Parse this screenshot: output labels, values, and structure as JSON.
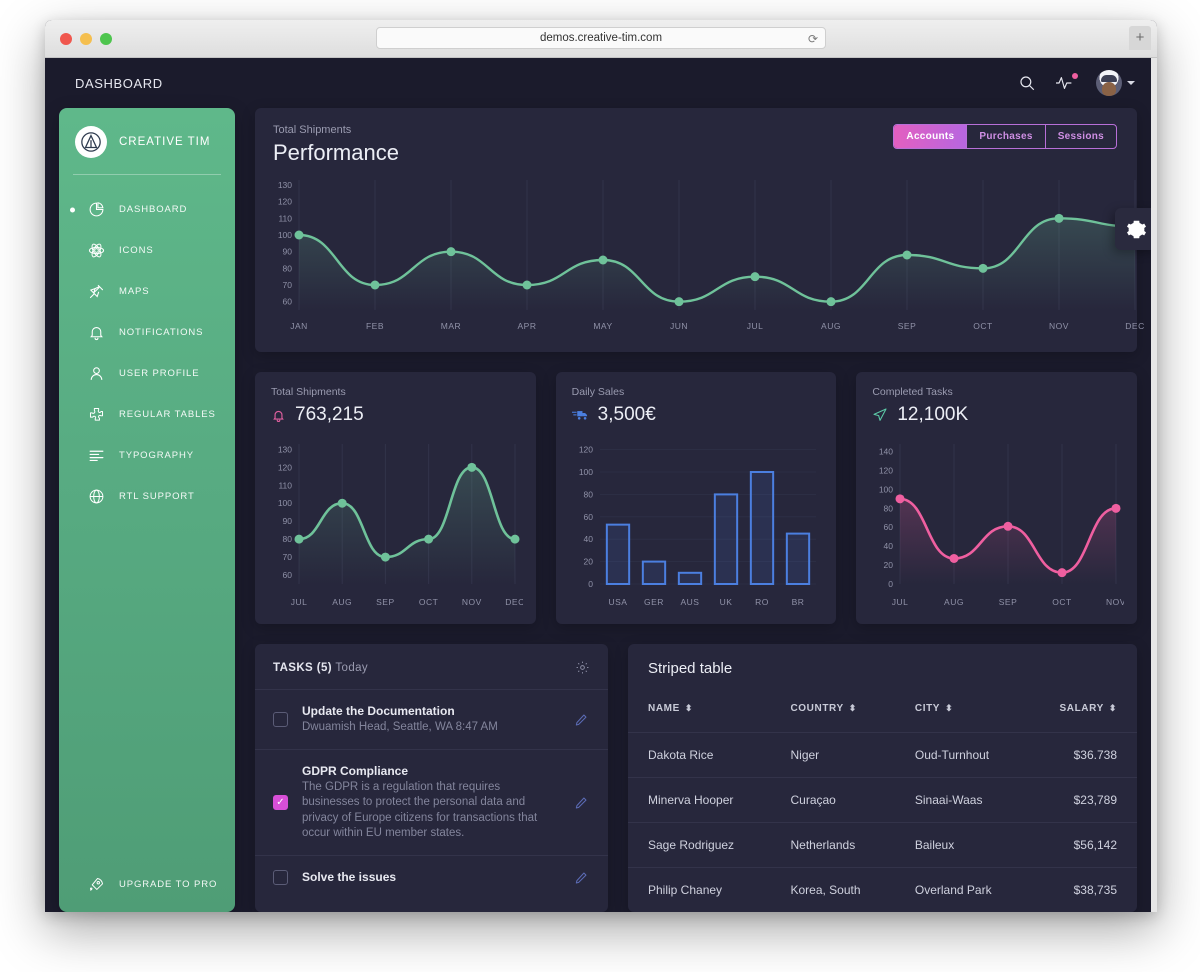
{
  "browser": {
    "url": "demos.creative-tim.com",
    "reload_icon": "reload-icon",
    "new_tab_label": "+"
  },
  "appbar": {
    "title": "DASHBOARD",
    "search_icon": "search-icon",
    "activity_icon": "activity-pulse-icon",
    "avatar": "user-avatar"
  },
  "sidebar": {
    "brand": "CREATIVE TIM",
    "items": [
      {
        "label": "DASHBOARD",
        "icon": "pie-chart-icon",
        "active": true
      },
      {
        "label": "ICONS",
        "icon": "atom-icon",
        "active": false
      },
      {
        "label": "MAPS",
        "icon": "pin-icon",
        "active": false
      },
      {
        "label": "NOTIFICATIONS",
        "icon": "bell-icon",
        "active": false
      },
      {
        "label": "USER PROFILE",
        "icon": "user-icon",
        "active": false
      },
      {
        "label": "REGULAR TABLES",
        "icon": "puzzle-icon",
        "active": false
      },
      {
        "label": "TYPOGRAPHY",
        "icon": "text-align-icon",
        "active": false
      },
      {
        "label": "RTL SUPPORT",
        "icon": "globe-icon",
        "active": false
      }
    ],
    "footer": {
      "label": "UPGRADE TO PRO",
      "icon": "rocket-icon"
    }
  },
  "performance": {
    "subtitle": "Total Shipments",
    "title": "Performance",
    "toggles": [
      {
        "label": "Accounts",
        "active": true
      },
      {
        "label": "Purchases",
        "active": false
      },
      {
        "label": "Sessions",
        "active": false
      }
    ]
  },
  "settings_fab": {
    "icon": "gear-icon"
  },
  "stats": [
    {
      "label": "Total Shipments",
      "value": "763,215",
      "icon": "bell-icon",
      "icon_color": "#e0609f"
    },
    {
      "label": "Daily Sales",
      "value": "3,500€",
      "icon": "shipping-fast-icon",
      "icon_color": "#4b7fe0"
    },
    {
      "label": "Completed Tasks",
      "value": "12,100K",
      "icon": "send-icon",
      "icon_color": "#5cc9a7"
    }
  ],
  "tasks_panel": {
    "title_bold": "TASKS (5)",
    "title_rest": "Today",
    "settings_icon": "gear-icon",
    "items": [
      {
        "checked": false,
        "name": "Update the Documentation",
        "desc": "Dwuamish Head, Seattle, WA 8:47 AM",
        "edit_icon": "pencil-icon"
      },
      {
        "checked": true,
        "name": "GDPR Compliance",
        "desc": "The GDPR is a regulation that requires businesses to protect the personal data and privacy of Europe citizens for transactions that occur within EU member states.",
        "edit_icon": "pencil-icon"
      },
      {
        "checked": false,
        "name": "Solve the issues",
        "desc": "",
        "edit_icon": "pencil-icon"
      }
    ]
  },
  "table": {
    "title": "Striped table",
    "sort_icon": "sort-updown-icon",
    "columns": [
      "NAME",
      "COUNTRY",
      "CITY",
      "SALARY"
    ],
    "rows": [
      [
        "Dakota Rice",
        "Niger",
        "Oud-Turnhout",
        "$36.738"
      ],
      [
        "Minerva Hooper",
        "Curaçao",
        "Sinaai-Waas",
        "$23,789"
      ],
      [
        "Sage Rodriguez",
        "Netherlands",
        "Baileux",
        "$56,142"
      ],
      [
        "Philip Chaney",
        "Korea, South",
        "Overland Park",
        "$38,735"
      ]
    ]
  },
  "colors": {
    "accent_green": "#6fc29a",
    "accent_pink": "#ef5fa0",
    "accent_blue": "#4b7fe0",
    "accent_purple": "#b766e0",
    "card_bg": "#27273c",
    "page_bg": "#1b1b2c"
  },
  "chart_data": [
    {
      "type": "line",
      "name": "performance-chart",
      "title": "Performance",
      "subtitle": "Total Shipments",
      "categories": [
        "JAN",
        "FEB",
        "MAR",
        "APR",
        "MAY",
        "JUN",
        "JUL",
        "AUG",
        "SEP",
        "OCT",
        "NOV",
        "DEC"
      ],
      "values": [
        100,
        70,
        90,
        70,
        85,
        60,
        75,
        60,
        88,
        80,
        110,
        105
      ],
      "yticks": [
        60,
        70,
        80,
        90,
        100,
        110,
        120,
        130
      ],
      "ylim": [
        55,
        133
      ],
      "xlabel": "",
      "ylabel": "",
      "grid": "vertical",
      "color": "#6fc29a",
      "legend": "none"
    },
    {
      "type": "line",
      "name": "total-shipments-chart",
      "title": "Total Shipments",
      "categories": [
        "JUL",
        "AUG",
        "SEP",
        "OCT",
        "NOV",
        "DEC"
      ],
      "values": [
        80,
        100,
        70,
        80,
        120,
        80
      ],
      "yticks": [
        60,
        70,
        80,
        90,
        100,
        110,
        120,
        130
      ],
      "ylim": [
        55,
        133
      ],
      "grid": "vertical",
      "color": "#6fc29a",
      "legend": "none"
    },
    {
      "type": "bar",
      "name": "daily-sales-chart",
      "title": "Daily Sales",
      "categories": [
        "USA",
        "GER",
        "AUS",
        "UK",
        "RO",
        "BR"
      ],
      "values": [
        53,
        20,
        10,
        80,
        100,
        45
      ],
      "yticks": [
        0,
        20,
        40,
        60,
        80,
        100,
        120
      ],
      "ylim": [
        0,
        125
      ],
      "grid": "vertical",
      "color": "#4b7fe0",
      "legend": "none"
    },
    {
      "type": "line",
      "name": "completed-tasks-chart",
      "title": "Completed Tasks",
      "categories": [
        "JUL",
        "AUG",
        "SEP",
        "OCT",
        "NOV"
      ],
      "values": [
        90,
        27,
        61,
        12,
        80
      ],
      "yticks": [
        0,
        20,
        40,
        60,
        80,
        100,
        120,
        140
      ],
      "ylim": [
        0,
        148
      ],
      "grid": "vertical",
      "color": "#ef5fa0",
      "legend": "none"
    }
  ]
}
